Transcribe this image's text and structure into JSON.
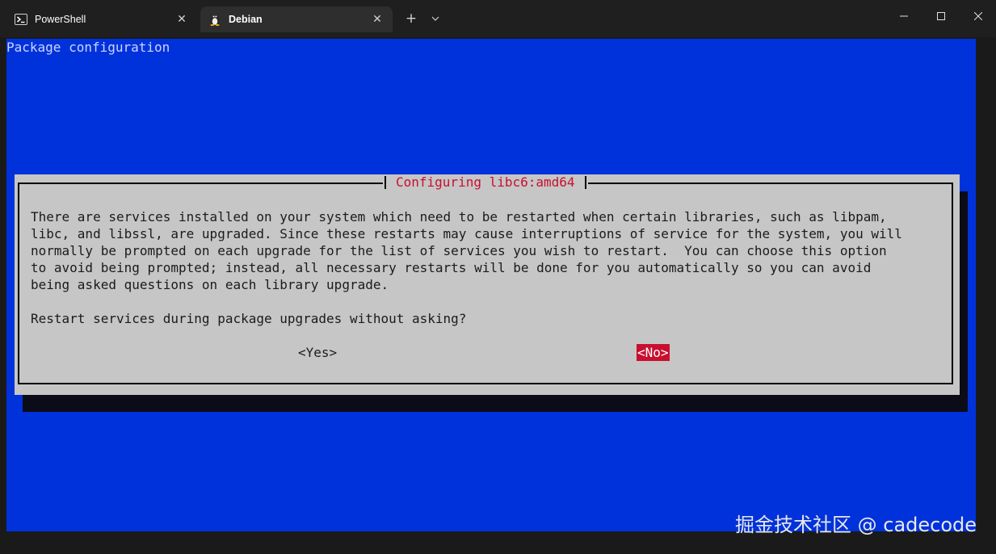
{
  "tabs": [
    {
      "title": "PowerShell",
      "icon": "powershell-icon"
    },
    {
      "title": "Debian",
      "icon": "linux-penguin-icon"
    }
  ],
  "icons": {
    "close": "close-icon",
    "new_tab": "plus-icon",
    "dropdown": "chevron-down-icon",
    "minimize": "minimize-icon",
    "maximize": "maximize-icon",
    "window_close": "window-close-icon"
  },
  "colors": {
    "terminal_bg": "#0032dc",
    "dialog_bg": "#c6c6c6",
    "accent_red": "#c8102e"
  },
  "terminal": {
    "backtitle": "Package configuration",
    "dialog": {
      "title": "Configuring libc6:amd64",
      "body": "There are services installed on your system which need to be restarted when certain libraries, such as libpam,\nlibc, and libssl, are upgraded. Since these restarts may cause interruptions of service for the system, you will\nnormally be prompted on each upgrade for the list of services you wish to restart.  You can choose this option\nto avoid being prompted; instead, all necessary restarts will be done for you automatically so you can avoid\nbeing asked questions on each library upgrade.",
      "question": "Restart services during package upgrades without asking?",
      "yes_label": "<Yes>",
      "no_label": "<No>",
      "selected": "<No>"
    }
  },
  "watermark": "掘金技术社区 @ cadecode"
}
